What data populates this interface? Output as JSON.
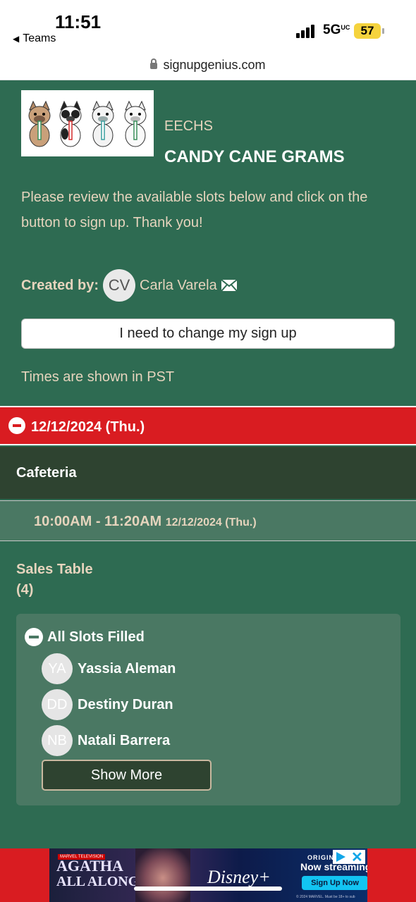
{
  "status_bar": {
    "time": "11:51",
    "back_app": "Teams",
    "network": "5G",
    "network_sup": "UC",
    "battery": "57"
  },
  "browser": {
    "url": "signupgenius.com"
  },
  "header": {
    "org": "EECHS",
    "title": "CANDY CANE GRAMS",
    "intro": "Please review the available slots below and click on the button to sign up. Thank you!",
    "created_label": "Created by:",
    "creator_initials": "CV",
    "creator_name": "Carla Varela",
    "change_button": "I need to change my sign up",
    "timezone_note": "Times are shown in PST"
  },
  "date_section": {
    "date": "12/12/2024 (Thu.)",
    "location": "Cafeteria",
    "time_range": "10:00AM - 11:20AM",
    "time_date": "12/12/2024 (Thu.)"
  },
  "slot": {
    "title": "Sales Table",
    "count": "(4)",
    "status": "All Slots Filled",
    "people": [
      {
        "initials": "YA",
        "name": "Yassia Aleman"
      },
      {
        "initials": "DD",
        "name": "Destiny Duran"
      },
      {
        "initials": "NB",
        "name": "Natali Barrera"
      }
    ],
    "show_more": "Show More"
  },
  "ad": {
    "brand": "MARVEL TELEVISION",
    "title_line1": "AGATHA",
    "title_line2": "ALL ALONG",
    "logo": "Disney+",
    "original": "ORIGINAL",
    "streaming": "Now streaming",
    "cta": "Sign Up Now",
    "legal": "© 2024 MARVEL. Must be 18+ to sub"
  },
  "colors": {
    "page_bg": "#2e6b52",
    "accent_red": "#d91c21",
    "dark_green": "#2e4330",
    "mid_green": "#4a7863",
    "tan_text": "#e6d4bd"
  }
}
